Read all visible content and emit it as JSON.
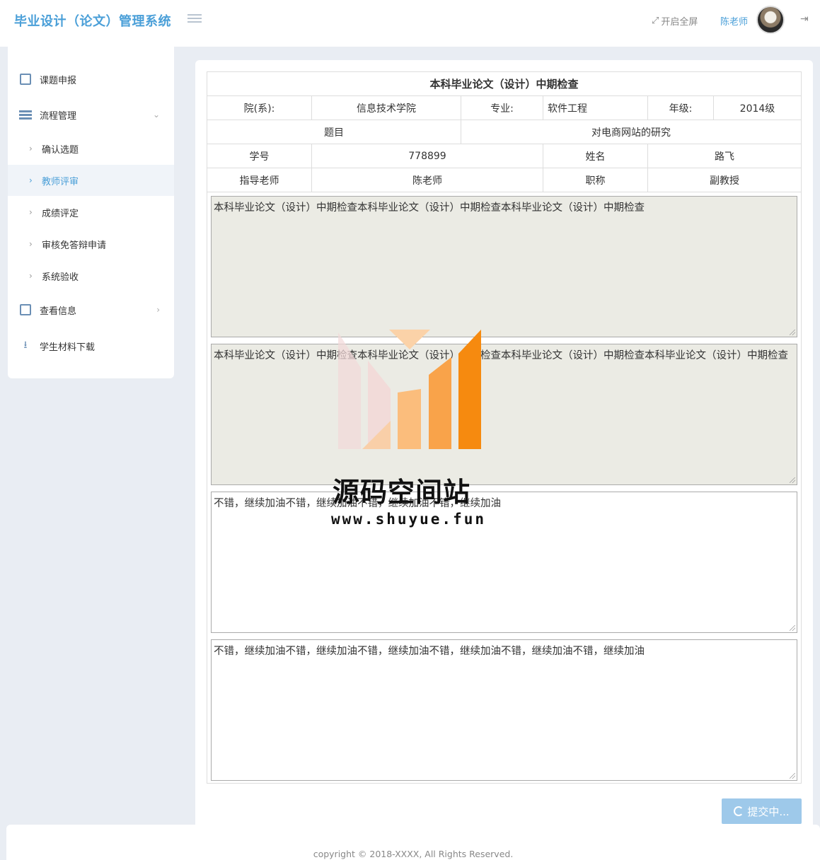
{
  "header": {
    "brand": "毕业设计（论文）管理系统",
    "fullscreen_label": "开启全屏",
    "username": "陈老师"
  },
  "sidebar": {
    "items": [
      {
        "label": "课题申报"
      },
      {
        "label": "流程管理"
      },
      {
        "label": "查看信息"
      },
      {
        "label": "学生材料下载"
      }
    ],
    "sub_items": [
      {
        "label": "确认选题"
      },
      {
        "label": "教师评审"
      },
      {
        "label": "成绩评定"
      },
      {
        "label": "审核免答辩申请"
      },
      {
        "label": "系统验收"
      }
    ]
  },
  "form": {
    "title": "本科毕业论文（设计）中期检查",
    "dept_label": "院(系):",
    "dept_value": "信息技术学院",
    "major_label": "专业:",
    "major_value": "软件工程",
    "grade_label": "年级:",
    "grade_value": "2014级",
    "topic_label": "题目",
    "topic_value": "对电商网站的研究",
    "student_id_label": "学号",
    "student_id_value": "778899",
    "name_label": "姓名",
    "name_value": "路飞",
    "advisor_label": "指导老师",
    "advisor_value": "陈老师",
    "title_rank_label": "职称",
    "title_rank_value": "副教授",
    "textareas": [
      "本科毕业论文（设计）中期检查本科毕业论文（设计）中期检查本科毕业论文（设计）中期检查",
      "本科毕业论文（设计）中期检查本科毕业论文（设计）中期检查本科毕业论文（设计）中期检查本科毕业论文（设计）中期检查",
      "不错，继续加油不错，继续加油不错，继续加油不错，继续加油",
      "不错，继续加油不错，继续加油不错，继续加油不错，继续加油不错，继续加油不错，继续加油"
    ],
    "submit_label": "提交中..."
  },
  "watermark": {
    "title": "源码空间站",
    "url": "www.shuyue.fun"
  },
  "footer": {
    "copyright": "copyright © 2018-XXXX, All Rights Reserved."
  },
  "colors": {
    "accent": "#4a9fd8",
    "background": "#e9edf3",
    "readonly_field": "#ebebe4",
    "submit": "#9ec9ea"
  }
}
